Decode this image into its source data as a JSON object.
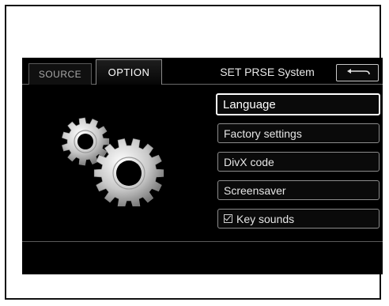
{
  "tabs": {
    "source_label": "SOURCE",
    "option_label": "OPTION"
  },
  "header": {
    "title": "SET PRSE System",
    "back_icon": "back-arrow-icon"
  },
  "menu": {
    "items": [
      {
        "label": "Language",
        "selected": true
      },
      {
        "label": "Factory settings"
      },
      {
        "label": "DivX code"
      },
      {
        "label": "Screensaver"
      },
      {
        "label": "Key sounds",
        "checkbox": true,
        "checked": true
      }
    ]
  },
  "illustration": {
    "icon": "gears-icon"
  },
  "colors": {
    "screen_background": "#000000",
    "text": "#e6e6e6",
    "border": "#8c8c8c",
    "selected_border": "#ffffff"
  }
}
